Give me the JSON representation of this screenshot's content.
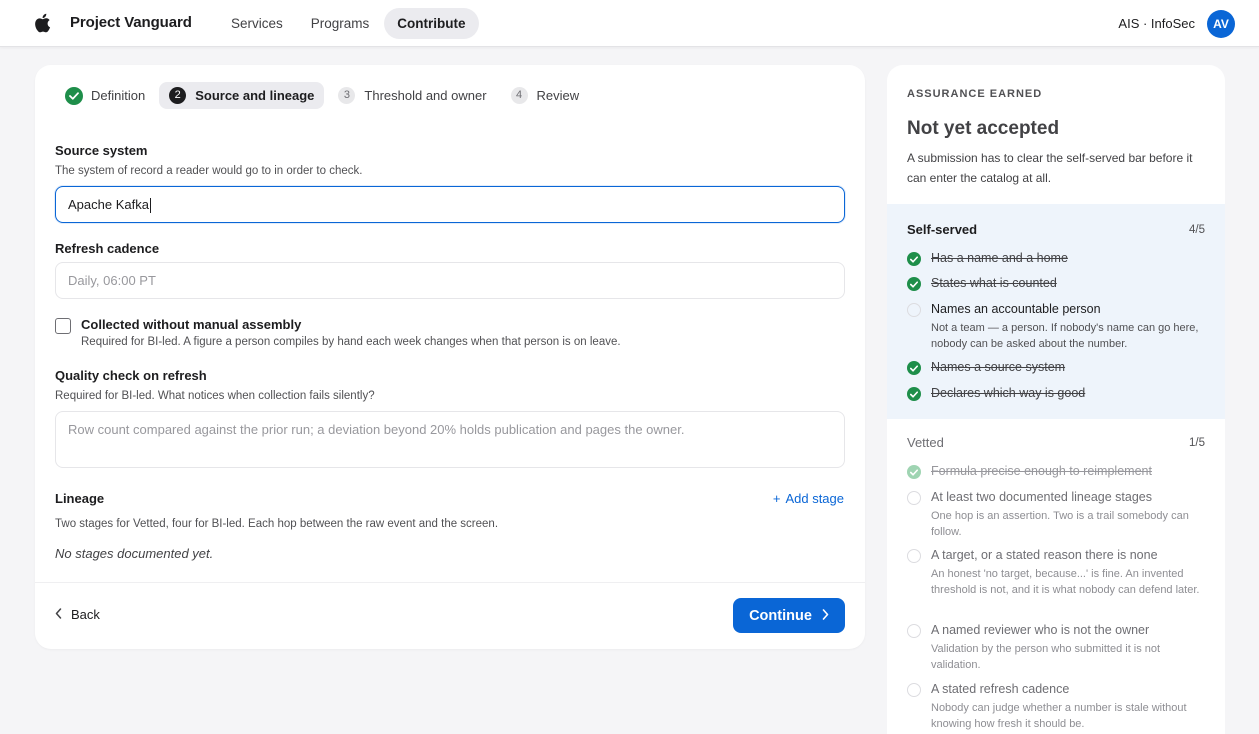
{
  "header": {
    "brand": "Project Vanguard",
    "nav": [
      "Services",
      "Programs",
      "Contribute"
    ],
    "active_nav": "Contribute",
    "org": "AIS · InfoSec",
    "avatar": "AV"
  },
  "steps": [
    {
      "num": "",
      "label": "Definition",
      "status": "done"
    },
    {
      "num": "2",
      "label": "Source and lineage",
      "status": "active"
    },
    {
      "num": "3",
      "label": "Threshold and owner",
      "status": "pending"
    },
    {
      "num": "4",
      "label": "Review",
      "status": "pending"
    }
  ],
  "form": {
    "source_system": {
      "label": "Source system",
      "help": "The system of record a reader would go to in order to check.",
      "value": "Apache Kafka"
    },
    "refresh": {
      "label": "Refresh cadence",
      "placeholder": "Daily, 06:00 PT"
    },
    "collected": {
      "label": "Collected without manual assembly",
      "help": "Required for BI-led. A figure a person compiles by hand each week changes when that person is on leave.",
      "checked": false
    },
    "quality": {
      "label": "Quality check on refresh",
      "help": "Required for BI-led. What notices when collection fails silently?",
      "placeholder": "Row count compared against the prior run; a deviation beyond 20% holds publication and pages the owner."
    },
    "lineage": {
      "label": "Lineage",
      "add": "Add stage",
      "help": "Two stages for Vetted, four for BI-led. Each hop between the raw event and the screen.",
      "empty": "No stages documented yet."
    },
    "back": "Back",
    "continue": "Continue"
  },
  "assurance": {
    "eyebrow": "ASSURANCE EARNED",
    "title": "Not yet accepted",
    "desc": "A submission has to clear the self-served bar before it can enter the catalog at all.",
    "self_served": {
      "name": "Self-served",
      "count": "4/5",
      "items": [
        {
          "text": "Has a name and a home",
          "met": true,
          "help": ""
        },
        {
          "text": "States what is counted",
          "met": true,
          "help": ""
        },
        {
          "text": "Names an accountable person",
          "met": false,
          "help": "Not a team — a person. If nobody's name can go here, nobody can be asked about the number."
        },
        {
          "text": "Names a source system",
          "met": true,
          "help": ""
        },
        {
          "text": "Declares which way is good",
          "met": true,
          "help": ""
        }
      ]
    },
    "vetted": {
      "name": "Vetted",
      "count": "1/5",
      "items": [
        {
          "text": "Formula precise enough to reimplement",
          "met": true,
          "help": ""
        },
        {
          "text": "At least two documented lineage stages",
          "met": false,
          "help": "One hop is an assertion. Two is a trail somebody can follow."
        },
        {
          "text": "A target, or a stated reason there is none",
          "met": false,
          "help": "An honest 'no target, because...' is fine. An invented threshold is not, and it is what nobody can defend later."
        },
        {
          "text": "A named reviewer who is not the owner",
          "met": false,
          "help": "Validation by the person who submitted it is not validation."
        },
        {
          "text": "A stated refresh cadence",
          "met": false,
          "help": "Nobody can judge whether a number is stale without knowing how fresh it should be."
        }
      ]
    }
  },
  "colors": {
    "accent": "#0a66d6",
    "success": "#1e8e4a",
    "tier_bg": "#eef4fb"
  }
}
